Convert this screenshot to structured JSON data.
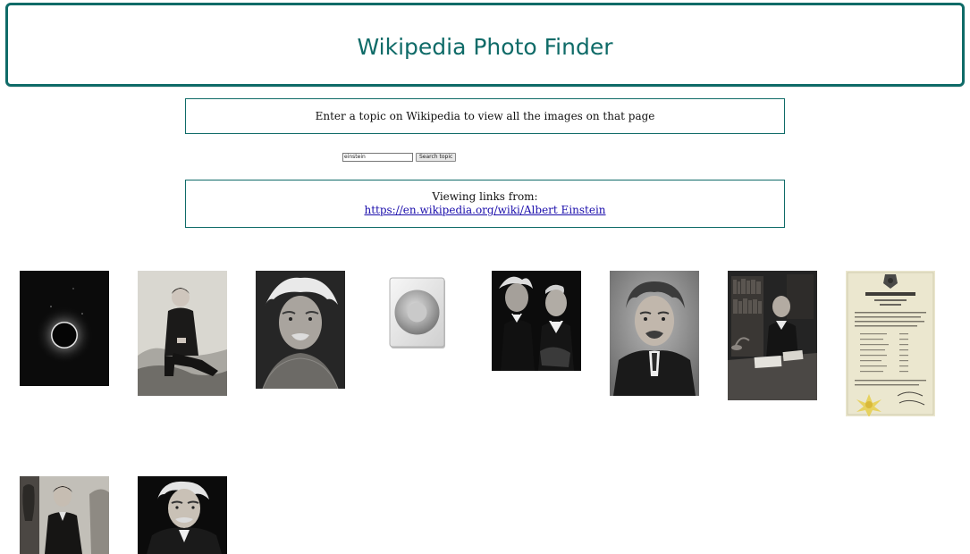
{
  "header": {
    "title": "Wikipedia Photo Finder"
  },
  "intro": {
    "text": "Enter a topic on Wikipedia to view all the images on that page"
  },
  "search": {
    "value": "einstein",
    "button_label": "Search topic"
  },
  "viewing": {
    "label": "Viewing links from:",
    "url": "https://en.wikipedia.org/wiki/Albert Einstein"
  },
  "gallery": {
    "images": [
      {
        "name": "solar-eclipse-photo"
      },
      {
        "name": "boy-sitting-portrait-photo"
      },
      {
        "name": "einstein-portrait-photo"
      },
      {
        "name": "speaker-icon"
      },
      {
        "name": "einstein-chaplin-photo"
      },
      {
        "name": "einstein-portrait-suit-photo"
      },
      {
        "name": "einstein-at-desk-photo"
      },
      {
        "name": "certificate-document-image"
      },
      {
        "name": "child-portrait-photo"
      },
      {
        "name": "einstein-profile-photo"
      }
    ]
  },
  "colors": {
    "accent": "#0f6b68",
    "link": "#1a0dab"
  }
}
